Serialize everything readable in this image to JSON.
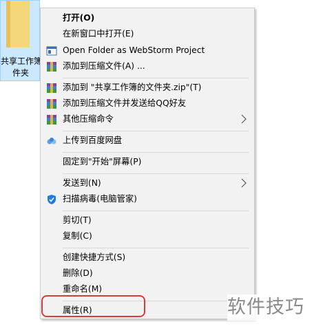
{
  "desktop": {
    "folder_label_line1": "共享工作簿",
    "folder_label_line2": "件夹"
  },
  "menu": {
    "items": [
      {
        "label": "打开(O)"
      },
      {
        "label": "在新窗口中打开(E)"
      },
      {
        "label": "Open Folder as WebStorm Project"
      },
      {
        "label": "添加到压缩文件(A) ..."
      },
      {
        "label": "添加到 \"共享工作簿的文件夹.zip\"(T)"
      },
      {
        "label": "添加到压缩文件并发送给QQ好友"
      },
      {
        "label": "其他压缩命令"
      },
      {
        "label": "上传到百度网盘"
      },
      {
        "label": "固定到\"开始\"屏幕(P)"
      },
      {
        "label": "发送到(N)"
      },
      {
        "label": "扫描病毒(电脑管家)"
      },
      {
        "label": "剪切(T)"
      },
      {
        "label": "复制(C)"
      },
      {
        "label": "创建快捷方式(S)"
      },
      {
        "label": "删除(D)"
      },
      {
        "label": "重命名(M)"
      },
      {
        "label": "属性(R)"
      }
    ]
  },
  "colors": {
    "menu_bg": "#f2f2f2",
    "highlight_ring": "#d83b3b",
    "folder_selection": "#cce8ff"
  },
  "watermark": {
    "text": "软件技巧"
  }
}
